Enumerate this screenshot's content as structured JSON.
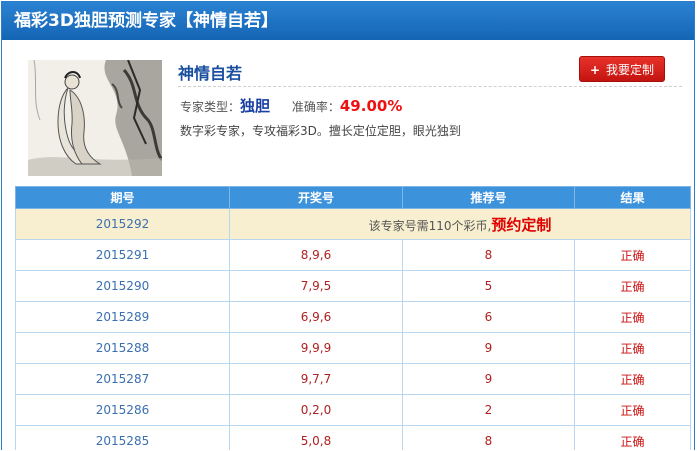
{
  "header": {
    "title": "福彩3D独胆预测专家【神情自若】"
  },
  "expert": {
    "name": "神情自若",
    "reserve_button": "我要定制",
    "type_label": "专家类型：",
    "type_value": "独胆",
    "accuracy_label": "准确率：",
    "accuracy_value": "49.00%",
    "description": "数字彩专家，专攻福彩3D。擅长定位定胆，眼光独到"
  },
  "table": {
    "headers": [
      "期号",
      "开奖号",
      "推荐号",
      "结果"
    ],
    "notice_row": {
      "period": "2015292",
      "text": "该专家号需110个彩币,",
      "link": "预约定制"
    },
    "rows": [
      {
        "period": "2015291",
        "draw": "8,9,6",
        "rec": "8",
        "result": "正确"
      },
      {
        "period": "2015290",
        "draw": "7,9,5",
        "rec": "5",
        "result": "正确"
      },
      {
        "period": "2015289",
        "draw": "6,9,6",
        "rec": "6",
        "result": "正确"
      },
      {
        "period": "2015288",
        "draw": "9,9,9",
        "rec": "9",
        "result": "正确"
      },
      {
        "period": "2015287",
        "draw": "9,7,7",
        "rec": "9",
        "result": "正确"
      },
      {
        "period": "2015286",
        "draw": "0,2,0",
        "rec": "2",
        "result": "正确"
      },
      {
        "period": "2015285",
        "draw": "5,0,8",
        "rec": "8",
        "result": "正确"
      }
    ]
  }
}
